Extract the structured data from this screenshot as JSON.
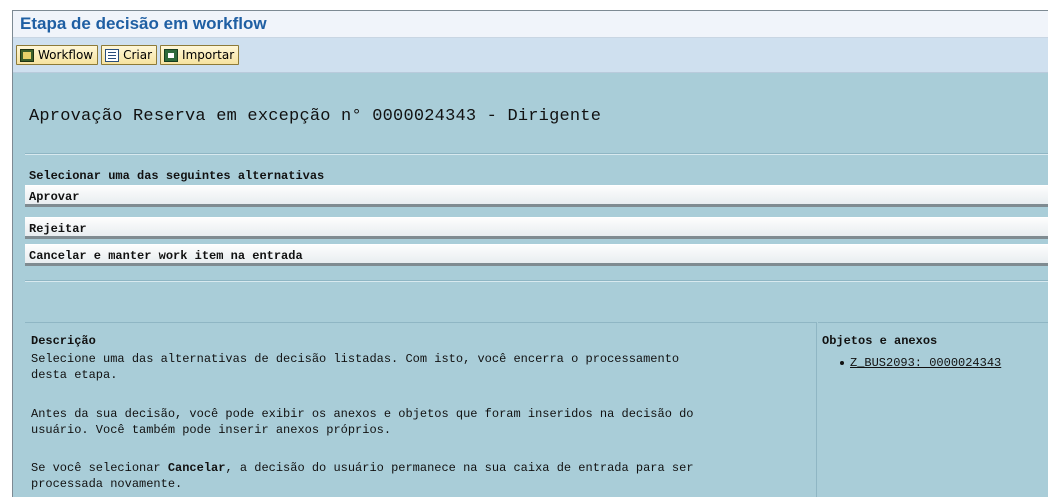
{
  "window": {
    "title": "Etapa de decisão em workflow"
  },
  "toolbar": {
    "buttons": [
      {
        "label": "Workflow",
        "icon": "workflow-icon"
      },
      {
        "label": "Criar",
        "icon": "create-document-icon"
      },
      {
        "label": "Importar",
        "icon": "import-icon"
      }
    ]
  },
  "main": {
    "heading": "Aprovação Reserva em excepção n° 0000024343 - Dirigente",
    "prompt": "Selecionar uma das seguintes alternativas",
    "options": [
      "Aprovar",
      "Rejeitar",
      "Cancelar e manter work item na entrada"
    ]
  },
  "description": {
    "title": "Descrição",
    "p1_line1": "Selecione uma das alternativas de decisão listadas. Com isto, você encerra o processamento",
    "p1_line2": "desta etapa.",
    "p2_line1": "Antes da sua decisão, você pode exibir os anexos e objetos que foram inseridos na decisão do",
    "p2_line2": "usuário. Você também pode inserir anexos próprios.",
    "p3_prefix": "Se você selecionar ",
    "p3_bold": "Cancelar",
    "p3_suffix": ", a decisão do usuário permanece na sua caixa de entrada para ser",
    "p3_line2": "processada novamente."
  },
  "objects": {
    "title": "Objetos e anexos",
    "items": [
      "Z_BUS2093: 0000024343"
    ]
  }
}
